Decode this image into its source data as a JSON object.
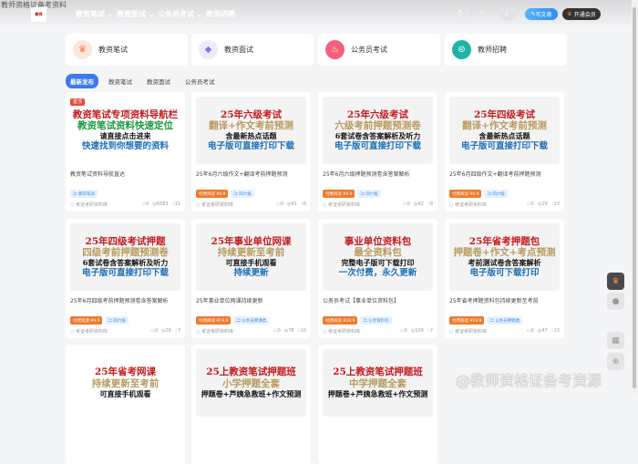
{
  "header": {
    "broken_logo_alt": "教师资格证备考资料",
    "logo_text": "教师",
    "nav": [
      "教资笔试 ⌄",
      "教资面试 ⌄",
      "公务员考试 ⌄",
      "教师招聘"
    ],
    "write_label": "写文章",
    "vip_label": "开通会员"
  },
  "categories": [
    {
      "label": "教资笔试",
      "icon": "crown-icon",
      "color": "#fbe6dc",
      "glyph": "♛",
      "fg": "#f07a3a"
    },
    {
      "label": "教资面试",
      "icon": "diamond-icon",
      "color": "#ecebfb",
      "glyph": "◆",
      "fg": "#8a75e8"
    },
    {
      "label": "公务员考试",
      "icon": "fire-icon",
      "color": "#f5607a",
      "glyph": "♨",
      "fg": "#fff"
    },
    {
      "label": "教师招聘",
      "icon": "globe-icon",
      "color": "#1fb3a8",
      "glyph": "⊜",
      "fg": "#fff"
    }
  ],
  "tabs": [
    "最新发布",
    "教资笔试",
    "教资面试",
    "公务员考试"
  ],
  "posts": [
    {
      "lines": [
        "教资笔试专项资料导航栏",
        "教资笔试资料快速定位",
        "请直接点击进来",
        "快速找到你想要的资料"
      ],
      "badge": "置顶",
      "title": "教资笔试资料导航直达",
      "paid": "",
      "tag": "教资笔试",
      "author": "考证考研资料库",
      "comments": "0",
      "views": "6583",
      "likes": "11"
    },
    {
      "lines": [
        "25年六级考试",
        "翻译+作文考前预测",
        "含最新热点话题",
        "电子版可直接打印下载"
      ],
      "title": "25年6月六级作文+翻译考前押题预测",
      "paid": "付费阅读 ¥9.9",
      "tag": "四六级",
      "author": "考证考研资料库",
      "comments": "0",
      "views": "41",
      "likes": "6"
    },
    {
      "lines": [
        "25年六级考试",
        "六级考前押题预测卷",
        "6套试卷含答案解析及听力",
        "电子版可直接打印下载"
      ],
      "title": "25年6月六级押题预测卷含答案解析",
      "paid": "付费阅读 ¥9.9",
      "tag": "四六级",
      "author": "考证考研资料库",
      "comments": "0",
      "views": "42",
      "likes": "8"
    },
    {
      "lines": [
        "25年四级考试",
        "翻译+作文考前预测",
        "含最新热点话题",
        "电子版可直接打印下载"
      ],
      "title": "25年6月四级作文+翻译考前押题预测",
      "paid": "付费阅读 ¥9.9",
      "tag": "四六级",
      "author": "考证考研资料库",
      "comments": "0",
      "views": "29",
      "likes": "13"
    },
    {
      "lines": [
        "25年四级考试押题",
        "四级考前押题预测卷",
        "6套试卷含答案解析及听力",
        "电子版可直接打印下载"
      ],
      "title": "25年6月四级考前押题预测卷含答案解析",
      "paid": "付费资源 ¥9.9",
      "tag": "四六级",
      "author": "考证考研资料库",
      "comments": "0",
      "views": "28",
      "likes": "7"
    },
    {
      "lines": [
        "25年事业单位网课",
        "持续更新至考前",
        "可直接手机观看",
        "持续更新"
      ],
      "title": "25年事业单位网课持续更新",
      "paid": "付费阅读 ¥19.9",
      "tag": "公务员网课类",
      "author": "考证考研资料库",
      "comments": "0",
      "views": "78",
      "likes": "10"
    },
    {
      "lines": [
        "事业单位资料包",
        "最全资料包",
        "完整电子版可下载打印",
        "一次付费，永久更新"
      ],
      "title": "公务员考试【事业单位资料包】",
      "paid": "付费阅读 ¥19.9",
      "tag": "公考资料包",
      "author": "考证考研资料库",
      "comments": "0",
      "views": "109",
      "likes": "7"
    },
    {
      "lines": [
        "25年省考押题包",
        "押题卷+作文+考点预测",
        "考前测试卷含答案解析",
        "电子版可下载打印"
      ],
      "title": "25年省考押题资料包持续更新至考前",
      "paid": "付费阅读 ¥19.9",
      "tag": "公务员押题类",
      "author": "考证考研资料库",
      "comments": "0",
      "views": "47",
      "likes": "13"
    },
    {
      "lines": [
        "25年省考网课",
        "持续更新至考前",
        "可直接手机观看",
        ""
      ]
    },
    {
      "lines": [
        "25上教资笔试押题班",
        "小学押题全套",
        "押题卷+芦姨急救班+作文预测",
        ""
      ]
    },
    {
      "lines": [
        "25上教资笔试押题班",
        "中学押题全套",
        "押题卷+芦姨急救班+作文预测",
        ""
      ]
    }
  ],
  "watermark": "@教师资格证备考资源"
}
